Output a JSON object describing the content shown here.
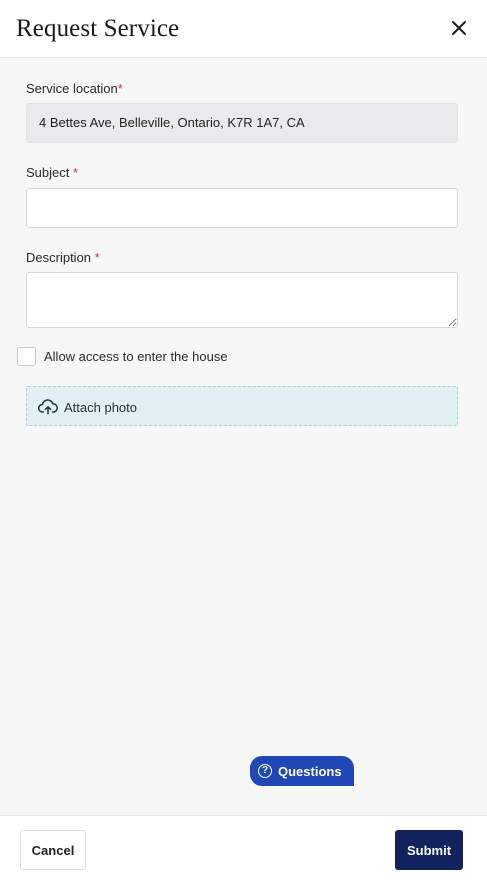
{
  "header": {
    "title": "Request Service",
    "close_icon": "close-icon"
  },
  "form": {
    "service_location": {
      "label": "Service location",
      "required_mark": "*",
      "value": "4 Bettes Ave, Belleville, Ontario, K7R 1A7, CA"
    },
    "subject": {
      "label": "Subject",
      "required_mark": "*",
      "value": "",
      "placeholder": ""
    },
    "description": {
      "label": "Description",
      "required_mark": "*",
      "value": "",
      "placeholder": ""
    },
    "allow_access": {
      "label": "Allow access to enter the house",
      "checked": false
    },
    "attach_photo": {
      "label": "Attach photo",
      "icon": "cloud-upload-icon"
    }
  },
  "help_button": {
    "label": "Questions",
    "icon": "question-circle-icon",
    "icon_glyph": "?"
  },
  "footer": {
    "cancel_label": "Cancel",
    "submit_label": "Submit"
  },
  "colors": {
    "primary": "#12225e",
    "help_button": "#1f47b5",
    "required": "#d9342b",
    "attach_bg": "#e1f1f3",
    "background": "#f7f7f7"
  }
}
